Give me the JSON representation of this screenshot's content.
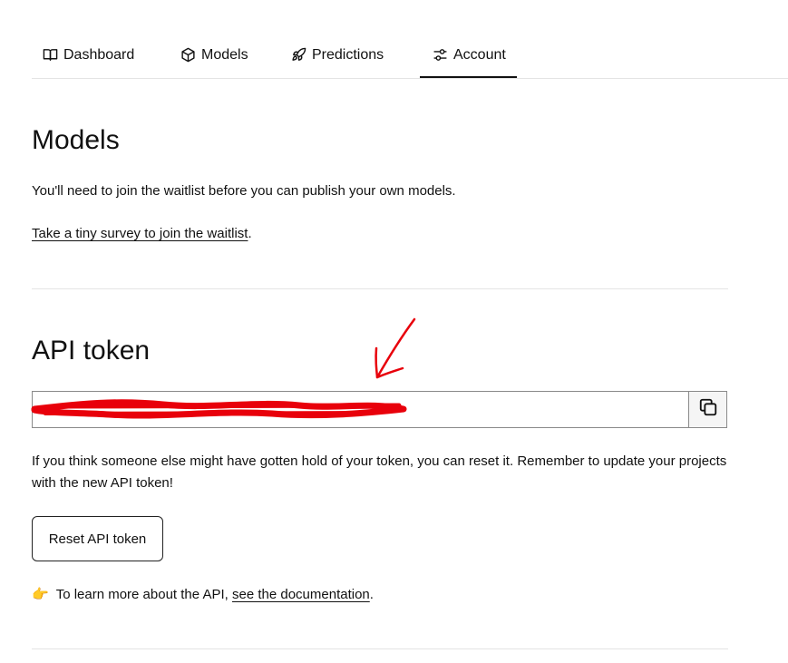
{
  "tabs": [
    {
      "label": "Dashboard",
      "icon": "book-icon"
    },
    {
      "label": "Models",
      "icon": "cube-icon"
    },
    {
      "label": "Predictions",
      "icon": "rocket-icon"
    },
    {
      "label": "Account",
      "icon": "sliders-icon",
      "active": true
    }
  ],
  "models_section": {
    "title": "Models",
    "waitlist_text": "You'll need to join the waitlist before you can publish your own models.",
    "survey_link": "Take a tiny survey to join the waitlist",
    "survey_suffix": "."
  },
  "api_section": {
    "title": "API token",
    "token_value": "",
    "reset_help": "If you think someone else might have gotten hold of your token, you can reset it. Remember to update your projects with the new API token!",
    "reset_button": "Reset API token",
    "learn_emoji": "👉",
    "learn_prefix": "To learn more about the API,",
    "docs_link": "see the documentation",
    "learn_suffix": "."
  },
  "colors": {
    "text": "#111111",
    "divider": "#e4e4e4",
    "annotation": "#e8000b"
  }
}
